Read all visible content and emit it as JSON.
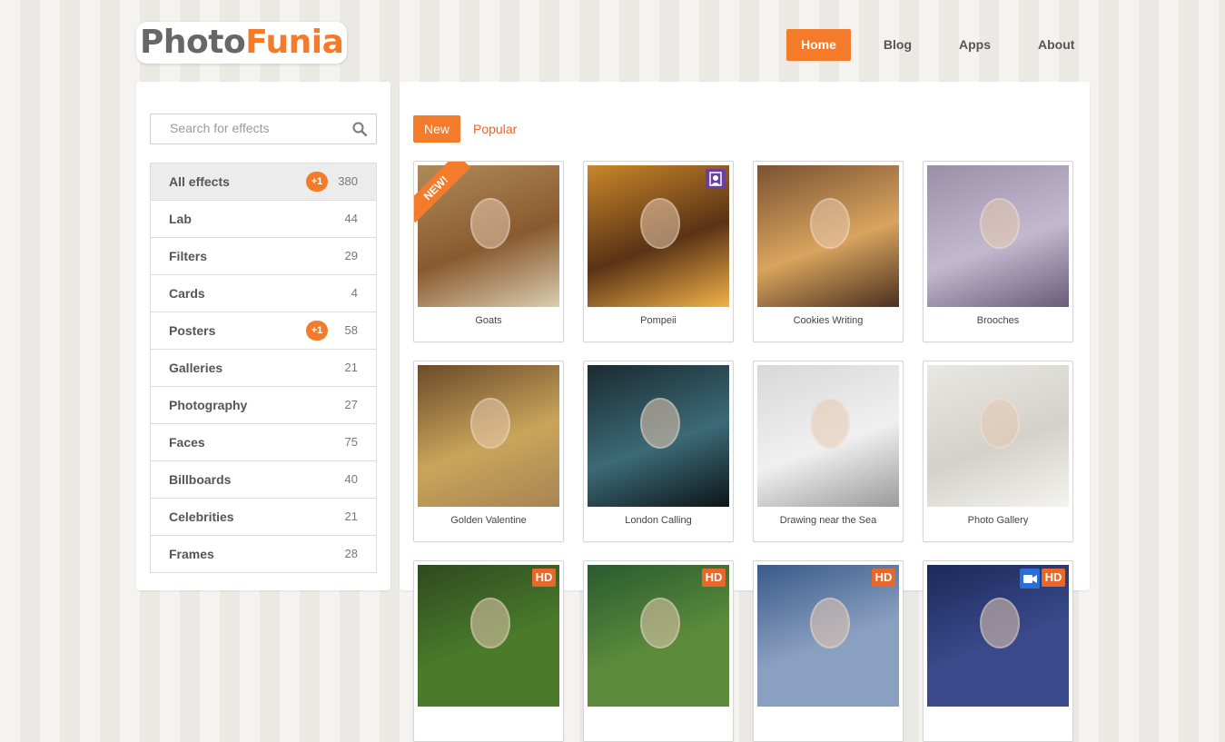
{
  "logo": {
    "part1": "Photo",
    "part2": "Funia"
  },
  "nav": [
    {
      "label": "Home",
      "active": true
    },
    {
      "label": "Blog",
      "active": false
    },
    {
      "label": "Apps",
      "active": false
    },
    {
      "label": "About",
      "active": false
    }
  ],
  "search": {
    "placeholder": "Search for effects",
    "value": ""
  },
  "categories": [
    {
      "label": "All effects",
      "count": "380",
      "badge": "+1",
      "active": true
    },
    {
      "label": "Lab",
      "count": "44"
    },
    {
      "label": "Filters",
      "count": "29"
    },
    {
      "label": "Cards",
      "count": "4"
    },
    {
      "label": "Posters",
      "count": "58",
      "badge": "+1"
    },
    {
      "label": "Galleries",
      "count": "21"
    },
    {
      "label": "Photography",
      "count": "27"
    },
    {
      "label": "Faces",
      "count": "75"
    },
    {
      "label": "Billboards",
      "count": "40"
    },
    {
      "label": "Celebrities",
      "count": "21"
    },
    {
      "label": "Frames",
      "count": "28"
    }
  ],
  "tabs": [
    {
      "label": "New",
      "active": true
    },
    {
      "label": "Popular",
      "active": false
    }
  ],
  "effects": [
    {
      "caption": "Goats",
      "ribbon": "NEW!",
      "palette": [
        "#b08a5a",
        "#8a5a2f",
        "#d9cdb0"
      ]
    },
    {
      "caption": "Pompeii",
      "badge_icon": "face-swap-icon",
      "palette": [
        "#c9872a",
        "#5a3215",
        "#f1b24a"
      ]
    },
    {
      "caption": "Cookies Writing",
      "palette": [
        "#7a5233",
        "#d9a45e",
        "#4a3020"
      ]
    },
    {
      "caption": "Brooches",
      "palette": [
        "#9a8fa8",
        "#c3b9cf",
        "#6a5c7a"
      ]
    },
    {
      "caption": "Golden Valentine",
      "palette": [
        "#6b4a2b",
        "#c9a55a",
        "#a88454"
      ]
    },
    {
      "caption": "London Calling",
      "palette": [
        "#1a2a30",
        "#3c6a78",
        "#0d1518"
      ]
    },
    {
      "caption": "Drawing near the Sea",
      "palette": [
        "#d8d8d8",
        "#f0f0f0",
        "#9a9a9a"
      ]
    },
    {
      "caption": "Photo Gallery",
      "palette": [
        "#e9e7e2",
        "#d4d1ca",
        "#f5f3ef"
      ]
    },
    {
      "caption": "",
      "hd": "HD",
      "palette": [
        "#2d4a20",
        "#4a7a2a"
      ]
    },
    {
      "caption": "",
      "hd": "HD",
      "palette": [
        "#2a5a30",
        "#5a8a3a"
      ]
    },
    {
      "caption": "",
      "hd": "HD",
      "palette": [
        "#3a5a8a",
        "#8aa0c0"
      ]
    },
    {
      "caption": "",
      "hd": "HD",
      "video_icon": "video-icon",
      "palette": [
        "#1a2a5a",
        "#3a4a8a"
      ]
    }
  ],
  "colors": {
    "accent": "#f47b2a",
    "text": "#555555"
  }
}
